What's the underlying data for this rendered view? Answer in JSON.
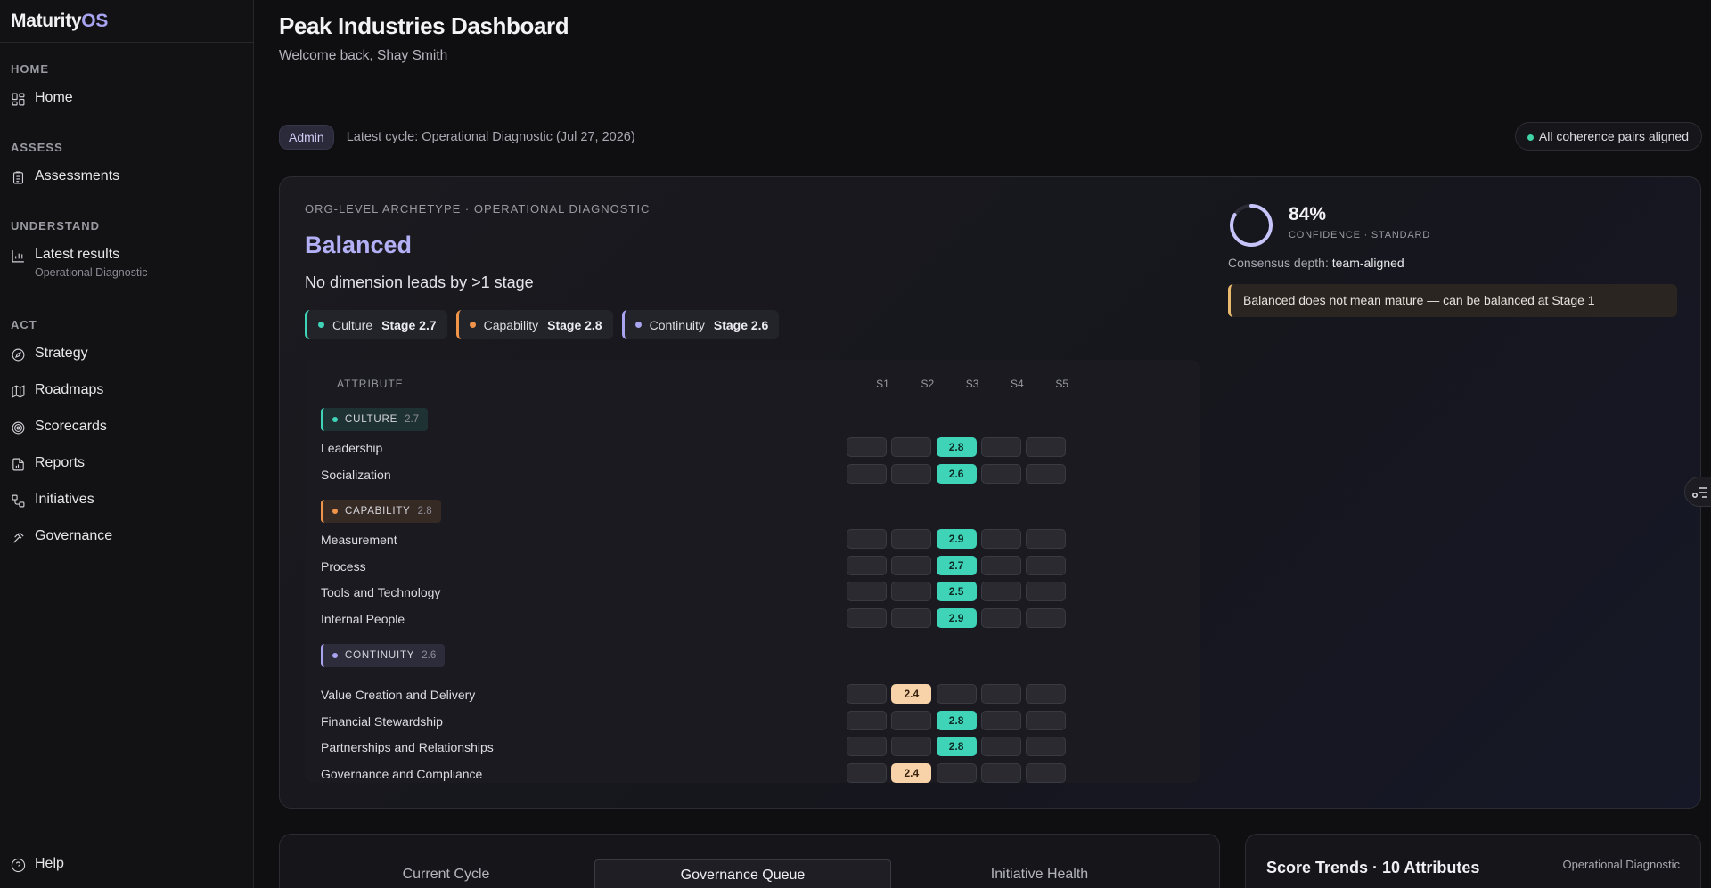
{
  "brand": {
    "name_main": "Maturity",
    "name_accent": "OS"
  },
  "sidebar": {
    "sections": [
      {
        "heading": "HOME",
        "items": [
          {
            "label": "Home",
            "icon": "grid-icon"
          }
        ]
      },
      {
        "heading": "ASSESS",
        "items": [
          {
            "label": "Assessments",
            "icon": "clipboard-icon"
          }
        ]
      },
      {
        "heading": "UNDERSTAND",
        "items": [
          {
            "label": "Latest results",
            "sub": "Operational Diagnostic",
            "icon": "bar-chart-icon"
          }
        ]
      },
      {
        "heading": "ACT",
        "items": [
          {
            "label": "Strategy",
            "icon": "compass-icon"
          },
          {
            "label": "Roadmaps",
            "icon": "map-icon"
          },
          {
            "label": "Scorecards",
            "icon": "target-icon"
          },
          {
            "label": "Reports",
            "icon": "file-chart-icon"
          },
          {
            "label": "Initiatives",
            "icon": "workflow-icon"
          },
          {
            "label": "Governance",
            "icon": "gavel-icon"
          }
        ]
      }
    ],
    "help_label": "Help"
  },
  "header": {
    "title": "Peak Industries Dashboard",
    "welcome": "Welcome back, Shay Smith",
    "role_badge": "Admin",
    "latest_cycle": "Latest cycle: Operational Diagnostic (Jul 27, 2026)",
    "coherence": "All coherence pairs aligned"
  },
  "archetype": {
    "eyebrow": "ORG-LEVEL ARCHETYPE · OPERATIONAL DIAGNOSTIC",
    "name": "Balanced",
    "description": "No dimension leads by >1 stage",
    "dimensions": [
      {
        "name": "Culture",
        "stage": "Stage 2.7",
        "color": "#3fd3b8"
      },
      {
        "name": "Capability",
        "stage": "Stage 2.8",
        "color": "#f0944a"
      },
      {
        "name": "Continuity",
        "stage": "Stage 2.6",
        "color": "#a8a4f0"
      }
    ],
    "confidence": {
      "percent": "84%",
      "value": 0.84,
      "label": "CONFIDENCE · STANDARD"
    },
    "consensus_label": "Consensus depth:",
    "consensus_value": "team-aligned",
    "warning": "Balanced does not mean mature — can be balanced at Stage 1"
  },
  "matrix": {
    "attribute_header": "ATTRIBUTE",
    "stage_headers": [
      "S1",
      "S2",
      "S3",
      "S4",
      "S5"
    ],
    "groups": [
      {
        "tag": "CULTURE",
        "value": "2.7",
        "color": "#3fd3b8",
        "rows": [
          {
            "name": "Leadership",
            "stage": 3,
            "score": "2.8"
          },
          {
            "name": "Socialization",
            "stage": 3,
            "score": "2.6"
          }
        ]
      },
      {
        "tag": "CAPABILITY",
        "value": "2.8",
        "color": "#f0944a",
        "rows": [
          {
            "name": "Measurement",
            "stage": 3,
            "score": "2.9"
          },
          {
            "name": "Process",
            "stage": 3,
            "score": "2.7"
          },
          {
            "name": "Tools and Technology",
            "stage": 3,
            "score": "2.5"
          },
          {
            "name": "Internal People",
            "stage": 3,
            "score": "2.9"
          }
        ]
      },
      {
        "tag": "CONTINUITY",
        "value": "2.6",
        "color": "#a8a4f0",
        "rows": [
          {
            "name": "Value Creation and Delivery",
            "stage": 2,
            "score": "2.4"
          },
          {
            "name": "Financial Stewardship",
            "stage": 3,
            "score": "2.8"
          },
          {
            "name": "Partnerships and Relationships",
            "stage": 3,
            "score": "2.8"
          },
          {
            "name": "Governance and Compliance",
            "stage": 2,
            "score": "2.4"
          }
        ]
      }
    ]
  },
  "bottom": {
    "tabs": [
      "Current Cycle",
      "Governance Queue",
      "Initiative Health"
    ],
    "active_tab": 1,
    "trends_title": "Score Trends · 10 Attributes",
    "trends_sub": "Operational Diagnostic"
  }
}
